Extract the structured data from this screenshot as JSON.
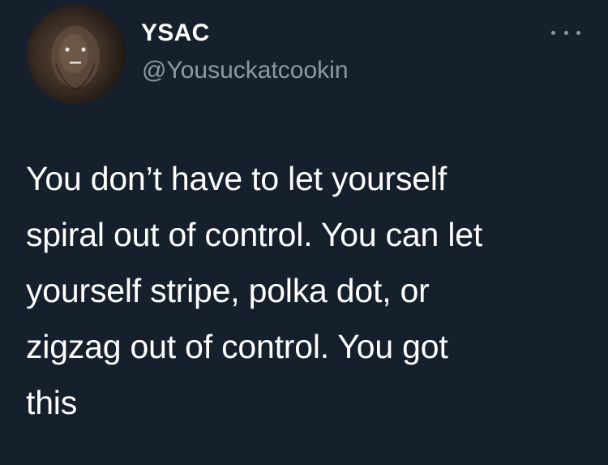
{
  "author": {
    "display_name": "YSAC",
    "handle": "@Yousuckatcookin",
    "avatar_icon": "avatar-image"
  },
  "menu": {
    "icon": "more-options-icon"
  },
  "tweet": {
    "text": "You don’t have to let yourself\nspiral out of control. You can let\nyourself stripe, polka dot, or\nzigzag out of control. You got\nthis"
  },
  "colors": {
    "background": "#16202c",
    "primary_text": "#ffffff",
    "secondary_text": "#8b98a5"
  }
}
